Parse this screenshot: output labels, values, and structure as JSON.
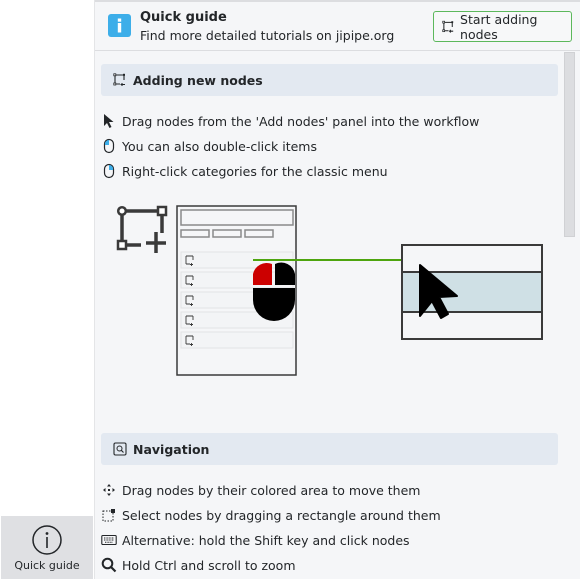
{
  "sidebar": {
    "buttons": [
      {
        "label": "Quick guide",
        "icon": "info-circle-icon"
      }
    ]
  },
  "header": {
    "title": "Quick guide",
    "subtitle": "Find more detailed tutorials on jipipe.org",
    "icon": "info-icon",
    "action_button": {
      "label": "Start adding nodes",
      "icon": "add-node-icon"
    },
    "accent_color": "#3daee9",
    "button_border_color": "#5cb85c"
  },
  "sections": [
    {
      "title": "Adding new nodes",
      "icon": "add-node-icon",
      "items": [
        {
          "icon": "cursor-icon",
          "text": "Drag nodes from the 'Add nodes' panel into the workflow"
        },
        {
          "icon": "mouse-left-icon",
          "text": "You can also double-click items"
        },
        {
          "icon": "mouse-right-icon",
          "text": "Right-click categories for the classic menu"
        }
      ]
    },
    {
      "title": "Navigation",
      "icon": "zoom-frame-icon",
      "items": [
        {
          "icon": "move-icon",
          "text": "Drag nodes by their colored area to move them"
        },
        {
          "icon": "select-rectangle-icon",
          "text": "Select nodes by dragging a rectangle around them"
        },
        {
          "icon": "keyboard-icon",
          "text": "Alternative: hold the Shift key and click nodes"
        },
        {
          "icon": "magnifier-icon",
          "text": "Hold Ctrl and scroll to zoom"
        }
      ]
    }
  ],
  "illustration": {
    "arrow_color": "#4ea50f",
    "mouse_button_color": "#cc0000",
    "highlight_color": "#cfe0e5"
  }
}
